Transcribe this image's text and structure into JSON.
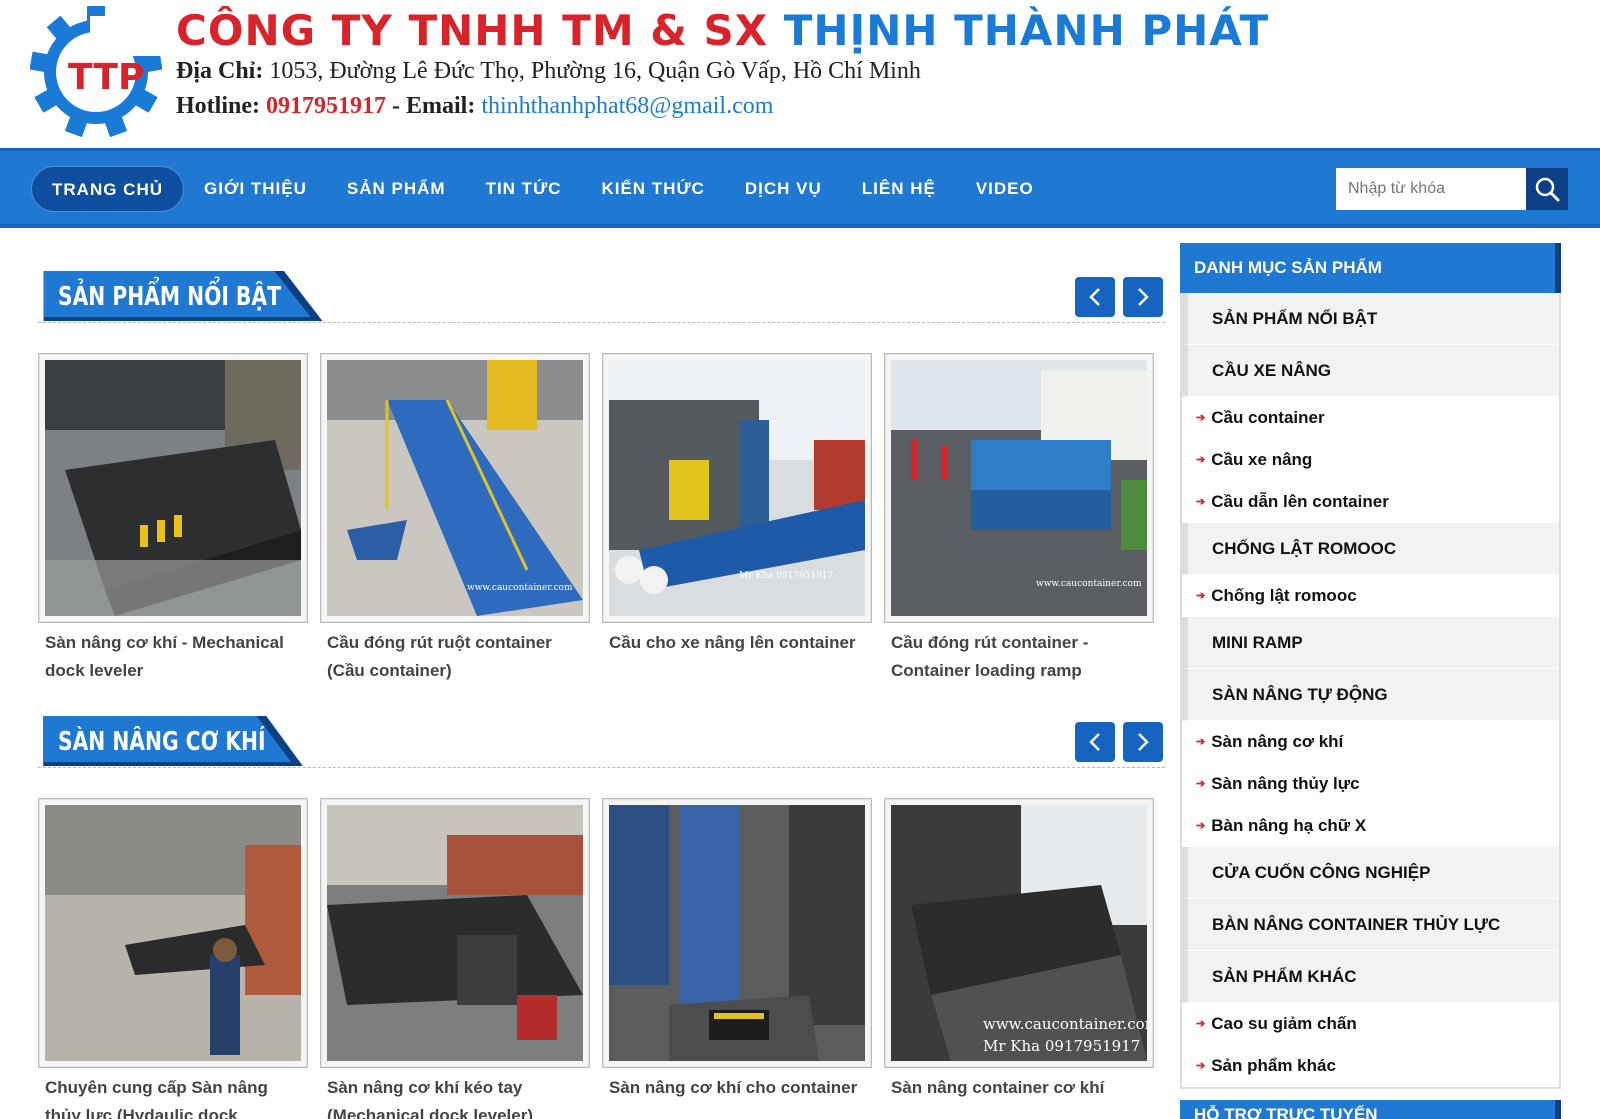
{
  "header": {
    "logo_text": "TTP",
    "company_name_part1": "CÔNG TY TNHH TM & SX",
    "company_name_part2": "THỊNH THÀNH PHÁT",
    "address_label": "Địa Chỉ:",
    "address": "1053, Đường Lê Đức Thọ, Phường 16, Quận Gò Vấp, Hồ Chí Minh",
    "hotline_label": "Hotline:",
    "hotline": "0917951917",
    "email_label": "- Email:",
    "email": "thinhthanhphat68@gmail.com"
  },
  "nav": {
    "items": [
      "TRANG CHỦ",
      "GIỚI THIỆU",
      "SẢN PHẨM",
      "TIN TỨC",
      "KIẾN THỨC",
      "DỊCH VỤ",
      "LIÊN HỆ",
      "VIDEO"
    ],
    "active": "TRANG CHỦ",
    "search_placeholder": "Nhập từ khóa"
  },
  "sections": [
    {
      "title": "SẢN PHẨM NỔI BẬT",
      "products": [
        "Sàn nâng cơ khí - Mechanical dock leveler",
        "Cầu đóng rút ruột container (Cầu container)",
        "Cầu cho xe nâng lên container",
        "Cầu đóng rút container - Container loading ramp"
      ]
    },
    {
      "title": "SÀN NÂNG CƠ KHÍ",
      "products": [
        "Chuyên cung cấp Sàn nâng thủy lực (Hydaulic dock",
        "Sàn nâng cơ khí kéo tay (Mechanical dock leveler)",
        "Sàn nâng cơ khí cho container",
        "Sàn nâng container cơ khí"
      ]
    }
  ],
  "photo_captions": {
    "p2": "www.caucontainer.com",
    "p3": "Mr Kha 0917951917",
    "p4": "www.caucontainer.com",
    "p8a": "www.caucontainer.com",
    "p8b": "Mr Kha 0917951917"
  },
  "sidebar": {
    "title": "DANH MỤC SẢN PHẨM",
    "categories": [
      {
        "label": "SẢN PHẨM NỔI BẬT",
        "children": []
      },
      {
        "label": "CẦU XE NÂNG",
        "children": [
          "Cầu container",
          "Cầu xe nâng",
          "Cầu dẫn lên container"
        ]
      },
      {
        "label": "CHỐNG LẬT ROMOOC",
        "children": [
          "Chống lật romooc"
        ]
      },
      {
        "label": "MINI RAMP",
        "children": []
      },
      {
        "label": "SÀN NÂNG TỰ ĐỘNG",
        "children": [
          "Sàn nâng cơ khí",
          "Sàn nâng thủy lực",
          "Bàn nâng hạ chữ X"
        ]
      },
      {
        "label": "CỬA CUỐN CÔNG NGHIỆP",
        "children": []
      },
      {
        "label": "BÀN NÂNG CONTAINER THỦY LỰC",
        "children": []
      },
      {
        "label": "SẢN PHẨM KHÁC",
        "children": [
          "Cao su giảm chấn",
          "Sản phẩm khác"
        ]
      }
    ],
    "second_title": "HỖ TRỢ TRỰC TUYẾN"
  },
  "colors": {
    "brand_red": "#d8232a",
    "brand_blue": "#1f78d1",
    "dark_blue": "#0d3f85"
  }
}
